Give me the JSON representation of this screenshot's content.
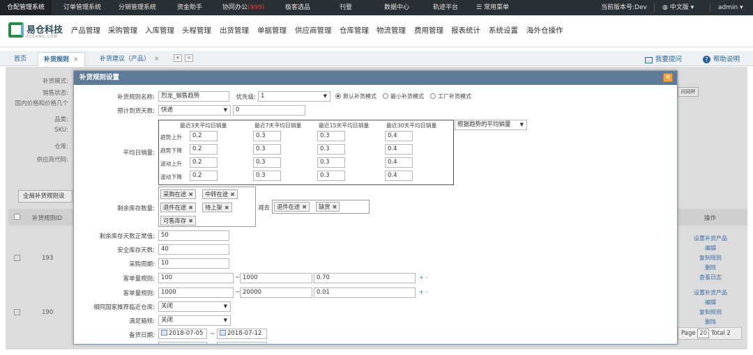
{
  "topbar": {
    "items": [
      "仓配管理系统",
      "订单管理系统",
      "分销管理系统",
      "资金助手",
      "协同办公",
      "极客选品",
      "刊登",
      "数据中心",
      "轨迹平台",
      "常用菜单"
    ],
    "office_badge": "(999)",
    "version": "当前版本号:Dev",
    "language": "中文版",
    "user": "admin"
  },
  "logo": {
    "name": "易仓科技",
    "sub": "ECCANG.COM"
  },
  "mainmenu": [
    "产品管理",
    "采购管理",
    "入库管理",
    "头程管理",
    "出货管理",
    "单据管理",
    "供应商管理",
    "仓库管理",
    "物流管理",
    "费用管理",
    "报表统计",
    "系统设置",
    "海外仓操作"
  ],
  "tabs": {
    "home": "首页",
    "rules": "补货规则",
    "suggest": "补货建议（产品）",
    "ask": "我要提问",
    "help": "帮助说明"
  },
  "background": {
    "labels": [
      "补货模式:",
      "销售状态:",
      "国内价格和价格几个",
      "品类:",
      "SKU:",
      "仓库:",
      "供应商代码:"
    ],
    "all_button": "全局补货规则设",
    "col_id": "补货规则ID",
    "col_op": "操作",
    "rows": [
      {
        "id": "193",
        "ops": [
          "设置补货产品",
          "编辑",
          "复制规则",
          "删除",
          "查看日志"
        ]
      },
      {
        "id": "190",
        "ops": [
          "设置补货产品",
          "编辑",
          "复制规则",
          "删除"
        ]
      }
    ],
    "right_tag": "问同杯",
    "pager": {
      "page_label": "Page",
      "page": "20",
      "total_label": "Total",
      "total": "2"
    }
  },
  "modal": {
    "title": "补货规则设置",
    "close": "×",
    "rule_name_label": "补货规则名称:",
    "rule_name": "烈龙_销售趋势",
    "priority_label": "优先级:",
    "priority": "1",
    "modes": [
      "默认补货模式",
      "最小补货模式",
      "工厂补货模式"
    ],
    "arrival_label": "预计到货天数:",
    "arrival_mode": "快递",
    "arrival_days": "0",
    "avg_label": "平均日销量:",
    "avg_headers": [
      "最近3天平均日销量",
      "最近7天平均日销量",
      "最近15天平均日销量",
      "最近30天平均日销量"
    ],
    "avg_rows": [
      {
        "label": "趋势上升",
        "values": [
          "0.2",
          "0.3",
          "0.3",
          "0.4"
        ]
      },
      {
        "label": "趋势下降",
        "values": [
          "0.2",
          "0.3",
          "0.3",
          "0.4"
        ]
      },
      {
        "label": "波动上升",
        "values": [
          "0.2",
          "0.3",
          "0.3",
          "0.4"
        ]
      },
      {
        "label": "波动下降",
        "values": [
          "0.2",
          "0.3",
          "0.3",
          "0.4"
        ]
      }
    ],
    "avg_basis": "根据趋势的平均销量",
    "stock_label": "剩余库存数量:",
    "stock_tags": [
      "采购在途",
      "中转在途",
      "退件在途",
      "待上架",
      "可售库存"
    ],
    "minus_label": "减去",
    "minus_tags": [
      "退件在途",
      "缺货"
    ],
    "normal_days_label": "剩余库存天数正常值:",
    "normal_days": "50",
    "safe_days_label": "安全库存天数:",
    "safe_days": "40",
    "purchase_cycle_label": "采购周期:",
    "purchase_cycle": "10",
    "order_rule_label": "客单量规则:",
    "order_rules": [
      {
        "from": "100",
        "to": "1000",
        "ratio": "0.70"
      },
      {
        "from": "1000",
        "to": "20000",
        "ratio": "0.01"
      }
    ],
    "plus_minus": "+ -",
    "tilde": "~",
    "same_country_label": "相同国家推荐临近仓库:",
    "same_country": "关闭",
    "box_label": "满足箱规:",
    "box": "关闭",
    "stock_date_label": "备货日期:",
    "date_from": "2018-07-05",
    "date_to": "2018-07-12"
  }
}
